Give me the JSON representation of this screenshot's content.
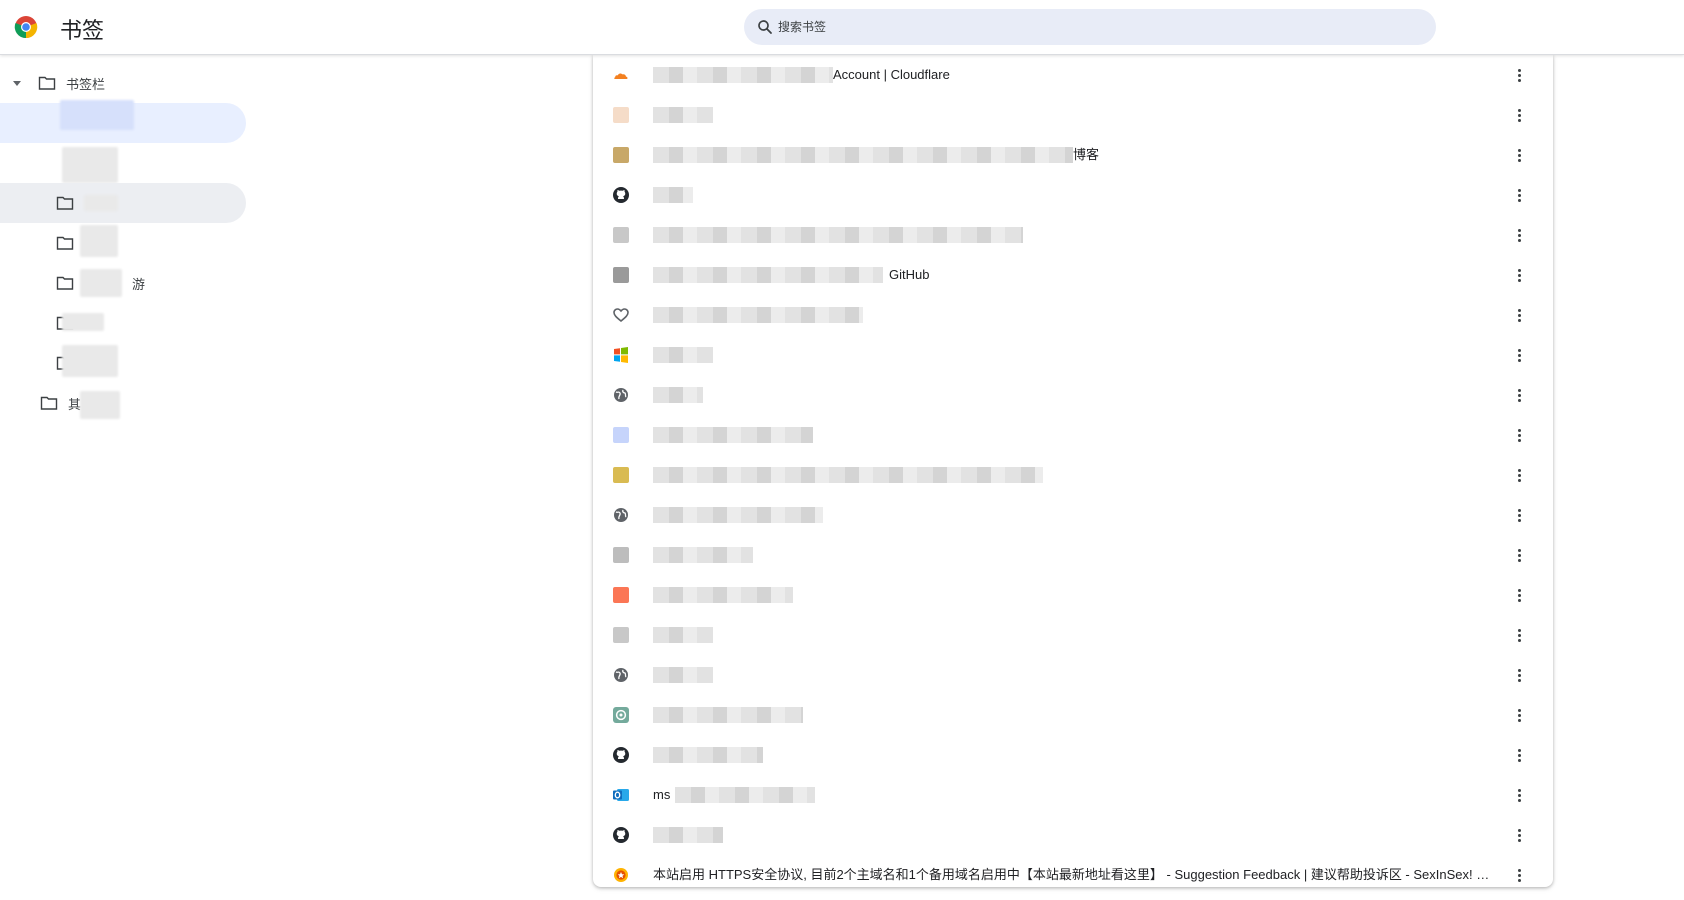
{
  "app": {
    "title": "书签"
  },
  "search": {
    "placeholder": "搜索书签"
  },
  "sidebar": {
    "items": [
      {
        "label": "书签栏",
        "expanded": true
      },
      {
        "label": "游"
      },
      {
        "label": "其"
      }
    ]
  },
  "bookmarks": [
    {
      "favicon": "cloudflare",
      "title": "Account | Cloudflare",
      "color": "#f38020"
    },
    {
      "favicon": "blurred",
      "title": "",
      "color": "#f5dcc8"
    },
    {
      "favicon": "blurred",
      "title": "博客",
      "color": "#c8a868"
    },
    {
      "favicon": "github-icon",
      "title": "",
      "color": "#24292f"
    },
    {
      "favicon": "blurred",
      "title": "",
      "color": "#c8c8c8"
    },
    {
      "favicon": "blurred",
      "title": "GitHub",
      "color": "#9a9a9a"
    },
    {
      "favicon": "heart-outline-icon",
      "title": "",
      "color": "#5f6368"
    },
    {
      "favicon": "windows-icon",
      "title": "",
      "color": "#f25022"
    },
    {
      "favicon": "globe-icon",
      "title": "",
      "color": "#5f6368"
    },
    {
      "favicon": "blurred",
      "title": "",
      "color": "#c6d4fb"
    },
    {
      "favicon": "blurred",
      "title": "",
      "color": "#d9bb52"
    },
    {
      "favicon": "globe-icon",
      "title": "",
      "color": "#5f6368"
    },
    {
      "favicon": "blurred",
      "title": "",
      "color": "#bdbdbd"
    },
    {
      "favicon": "blurred",
      "title": "",
      "color": "#fb7655"
    },
    {
      "favicon": "blurred",
      "title": "",
      "color": "#c8c8c8"
    },
    {
      "favicon": "globe-icon",
      "title": "",
      "color": "#5f6368"
    },
    {
      "favicon": "chatgpt-icon",
      "title": "",
      "color": "#74aa9c"
    },
    {
      "favicon": "github-icon",
      "title": "",
      "color": "#24292f"
    },
    {
      "favicon": "outlook-icon",
      "title": "ms",
      "color": "#0f6cbd"
    },
    {
      "favicon": "github-icon",
      "title": "",
      "color": "#24292f"
    },
    {
      "favicon": "badge-icon",
      "title": "本站启用 HTTPS安全协议, 目前2个主域名和1个备用域名启用中【本站最新地址看这里】 - Suggestion Feedback | 建议帮助投诉区 - SexInSex! Bo...",
      "color": "#e65100"
    }
  ]
}
